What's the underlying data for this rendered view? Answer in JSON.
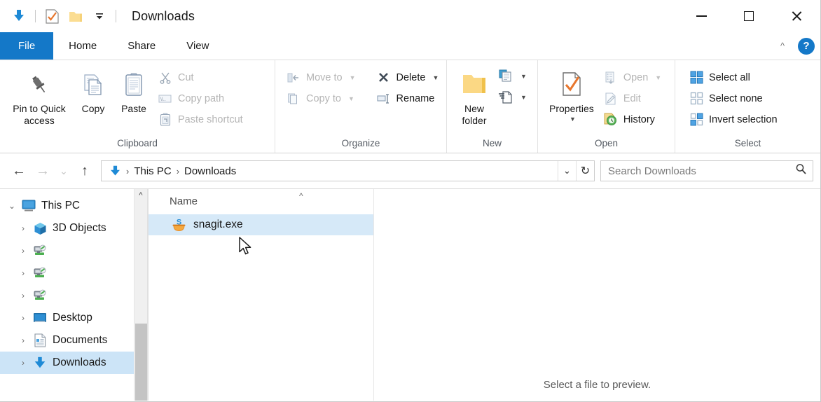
{
  "window": {
    "title": "Downloads",
    "quick_access": [
      "downloads-arrow-icon",
      "properties-icon",
      "new-folder-icon",
      "customize-qat-dropdown"
    ],
    "controls": {
      "minimize": "Minimize",
      "maximize": "Maximize",
      "close": "Close"
    }
  },
  "tabs": [
    {
      "id": "file",
      "label": "File",
      "active": false,
      "style": "file"
    },
    {
      "id": "home",
      "label": "Home",
      "active": true,
      "style": "normal"
    },
    {
      "id": "share",
      "label": "Share",
      "active": false,
      "style": "normal"
    },
    {
      "id": "view",
      "label": "View",
      "active": false,
      "style": "normal"
    }
  ],
  "ribbon_controls": {
    "collapse": "collapse-ribbon-chevron",
    "help": "?"
  },
  "ribbon": {
    "groups": [
      {
        "label": "Clipboard",
        "big": [
          {
            "label": "Pin to Quick access",
            "icon": "pin-icon",
            "disabled": false,
            "multiline": true
          },
          {
            "label": "Copy",
            "icon": "copy-icon",
            "disabled": false,
            "multiline": false
          },
          {
            "label": "Paste",
            "icon": "paste-icon",
            "disabled": false,
            "multiline": false
          }
        ],
        "small": [
          {
            "label": "Cut",
            "icon": "scissors-icon",
            "disabled": true,
            "caret": false
          },
          {
            "label": "Copy path",
            "icon": "copy-path-icon",
            "disabled": true,
            "caret": false
          },
          {
            "label": "Paste shortcut",
            "icon": "paste-shortcut-icon",
            "disabled": true,
            "caret": false
          }
        ]
      },
      {
        "label": "Organize",
        "small_left": [
          {
            "label": "Move to",
            "icon": "move-to-icon",
            "disabled": true,
            "caret": true
          },
          {
            "label": "Copy to",
            "icon": "copy-to-icon",
            "disabled": true,
            "caret": true
          }
        ],
        "small_right": [
          {
            "label": "Delete",
            "icon": "delete-x-icon",
            "disabled": false,
            "caret": true
          },
          {
            "label": "Rename",
            "icon": "rename-icon",
            "disabled": false,
            "caret": false
          }
        ]
      },
      {
        "label": "New",
        "big": [
          {
            "label": "New folder",
            "icon": "new-folder-icon",
            "disabled": false,
            "multiline": true
          }
        ],
        "small": [
          {
            "label": "",
            "icon": "new-item-icon",
            "disabled": false,
            "caret": true
          },
          {
            "label": "",
            "icon": "easy-access-icon",
            "disabled": false,
            "caret": true
          }
        ]
      },
      {
        "label": "Open",
        "big": [
          {
            "label": "Properties",
            "icon": "properties-icon",
            "disabled": false,
            "caret": true
          }
        ],
        "small": [
          {
            "label": "Open",
            "icon": "open-icon",
            "disabled": true,
            "caret": true
          },
          {
            "label": "Edit",
            "icon": "edit-icon",
            "disabled": true,
            "caret": false
          },
          {
            "label": "History",
            "icon": "history-icon",
            "disabled": false,
            "caret": false
          }
        ]
      },
      {
        "label": "Select",
        "small": [
          {
            "label": "Select all",
            "icon": "select-all-icon",
            "disabled": false,
            "caret": false
          },
          {
            "label": "Select none",
            "icon": "select-none-icon",
            "disabled": false,
            "caret": false
          },
          {
            "label": "Invert selection",
            "icon": "invert-selection-icon",
            "disabled": false,
            "caret": false
          }
        ]
      }
    ]
  },
  "address": {
    "back": "back-arrow-icon",
    "forward": "forward-arrow-icon",
    "recent": "recent-locations-chevron",
    "up": "up-arrow-icon",
    "crumb_icon": "downloads-arrow-icon",
    "crumbs": [
      "This PC",
      "Downloads"
    ],
    "separator": "›",
    "dropdown": "address-dropdown-chevron",
    "refresh": "refresh-icon"
  },
  "search": {
    "placeholder": "Search Downloads",
    "value": "",
    "icon": "search-icon"
  },
  "nav_tree": {
    "items": [
      {
        "label": "This PC",
        "icon": "this-pc-icon",
        "level": 1,
        "expander": "expanded",
        "selected": false
      },
      {
        "label": "3D Objects",
        "icon": "3d-objects-icon",
        "level": 2,
        "expander": "collapsed",
        "selected": false
      },
      {
        "label": "",
        "icon": "network-drive-icon",
        "level": 2,
        "expander": "collapsed",
        "selected": false
      },
      {
        "label": "",
        "icon": "network-drive-icon",
        "level": 2,
        "expander": "collapsed",
        "selected": false
      },
      {
        "label": "",
        "icon": "network-drive-icon",
        "level": 2,
        "expander": "collapsed",
        "selected": false
      },
      {
        "label": "Desktop",
        "icon": "desktop-icon",
        "level": 2,
        "expander": "collapsed",
        "selected": false
      },
      {
        "label": "Documents",
        "icon": "documents-icon",
        "level": 2,
        "expander": "collapsed",
        "selected": false
      },
      {
        "label": "Downloads",
        "icon": "downloads-icon",
        "level": 2,
        "expander": "collapsed",
        "selected": true
      }
    ],
    "scroll_up_arrow": "scroll-up-arrow"
  },
  "file_list": {
    "columns": [
      {
        "label": "Name",
        "sort": "ascending"
      }
    ],
    "rows": [
      {
        "name": "snagit.exe",
        "icon": "snagit-exe-icon",
        "selected": true
      }
    ]
  },
  "preview": {
    "message": "Select a file to preview."
  },
  "colors": {
    "accent": "#1478c8",
    "selection": "#cce4f7",
    "row_selection": "#d6e9f8",
    "download_arrow": "#1e8ad6",
    "folder_yellow": "#f6d27a",
    "snagit_orange": "#e8912d",
    "snagit_blue": "#2e8fd4"
  }
}
